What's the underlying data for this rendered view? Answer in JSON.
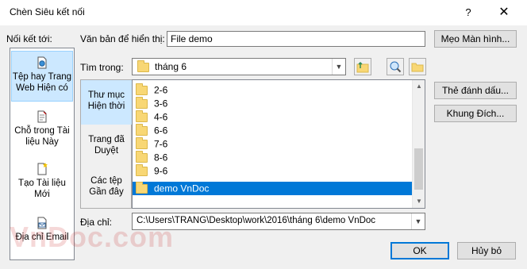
{
  "window": {
    "title": "Chèn Siêu kết nối",
    "help_glyph": "?",
    "close_glyph": "✕"
  },
  "link_to": {
    "label": "Nối kết tới:",
    "items": [
      {
        "label": "Tệp hay Trang Web Hiện có",
        "selected": true,
        "icon": "web-page-icon"
      },
      {
        "label": "Chỗ trong Tài liệu Này",
        "selected": false,
        "icon": "document-place-icon"
      },
      {
        "label": "Tạo Tài liệu Mới",
        "selected": false,
        "icon": "new-document-icon"
      },
      {
        "label": "Địa chỉ Email",
        "selected": false,
        "icon": "email-icon"
      }
    ]
  },
  "text_to_display": {
    "label": "Văn bản để hiển thị:",
    "value": "File demo"
  },
  "screentip_button": "Mẹo Màn hình...",
  "look_in": {
    "label": "Tìm trong:",
    "value": "tháng 6"
  },
  "side_tabs": [
    {
      "label": "Thư mục Hiện thời",
      "selected": true
    },
    {
      "label": "Trang đã Duyệt",
      "selected": false
    },
    {
      "label": "Các tệp Gần đây",
      "selected": false
    }
  ],
  "files": [
    {
      "name": "2-6",
      "selected": false
    },
    {
      "name": "3-6",
      "selected": false
    },
    {
      "name": "4-6",
      "selected": false
    },
    {
      "name": "6-6",
      "selected": false
    },
    {
      "name": "7-6",
      "selected": false
    },
    {
      "name": "8-6",
      "selected": false
    },
    {
      "name": "9-6",
      "selected": false
    },
    {
      "name": "demo VnDoc",
      "selected": true
    }
  ],
  "right_buttons": {
    "bookmark": "Thẻ đánh dấu...",
    "target_frame": "Khung Đích..."
  },
  "address": {
    "label": "Địa chỉ:",
    "value": "C:\\Users\\TRANG\\Desktop\\work\\2016\\tháng 6\\demo VnDoc"
  },
  "ok_button": "OK",
  "cancel_button": "Hủy bỏ",
  "watermark": "VnDoc.com",
  "colors": {
    "selection": "#0078d7",
    "link_selected_bg": "#cce8ff",
    "folder": "#f8d775"
  }
}
